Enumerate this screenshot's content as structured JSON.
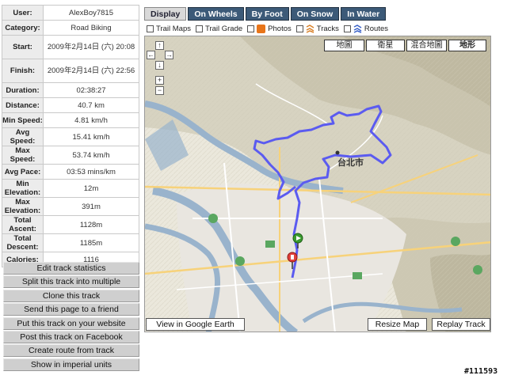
{
  "stats": [
    {
      "key": "User:",
      "value": "AlexBoy7815"
    },
    {
      "key": "Category:",
      "value": "Road Biking"
    },
    {
      "key": "Start:",
      "value": "2009年2月14日 (六) 20:08"
    },
    {
      "key": "Finish:",
      "value": "2009年2月14日 (六) 22:56"
    },
    {
      "key": "Duration:",
      "value": "02:38:27"
    },
    {
      "key": "Distance:",
      "value": "40.7 km"
    },
    {
      "key": "Min Speed:",
      "value": "4.81 km/h"
    },
    {
      "key": "Avg Speed:",
      "value": "15.41 km/h"
    },
    {
      "key": "Max Speed:",
      "value": "53.74 km/h"
    },
    {
      "key": "Avg Pace:",
      "value": "03:53 mins/km"
    },
    {
      "key": "Min Elevation:",
      "value": "12m"
    },
    {
      "key": "Max Elevation:",
      "value": "391m"
    },
    {
      "key": "Total Ascent:",
      "value": "1128m"
    },
    {
      "key": "Total Descent:",
      "value": "1185m"
    },
    {
      "key": "Calories:",
      "value": "1116"
    }
  ],
  "actions": [
    "Edit track statistics",
    "Split this track into multiple",
    "Clone this track",
    "Send this page to a friend",
    "Put this track on your website",
    "Post this track on Facebook",
    "Create route from track",
    "Show in imperial units"
  ],
  "tabs": [
    "Display",
    "On Wheels",
    "By Foot",
    "On Snow",
    "In Water"
  ],
  "layers": {
    "trail_maps": "Trail Maps",
    "trail_grade": "Trail Grade",
    "photos": "Photos",
    "tracks": "Tracks",
    "routes": "Routes"
  },
  "map": {
    "types": [
      "地圖",
      "衛星",
      "混合地圖",
      "地形"
    ],
    "selected_type": "地形",
    "city_label": "台北市",
    "view_google_earth": "View in Google Earth",
    "resize": "Resize Map",
    "replay": "Replay Track",
    "track_color": "#5b5bf0"
  },
  "watermark": "#111593"
}
